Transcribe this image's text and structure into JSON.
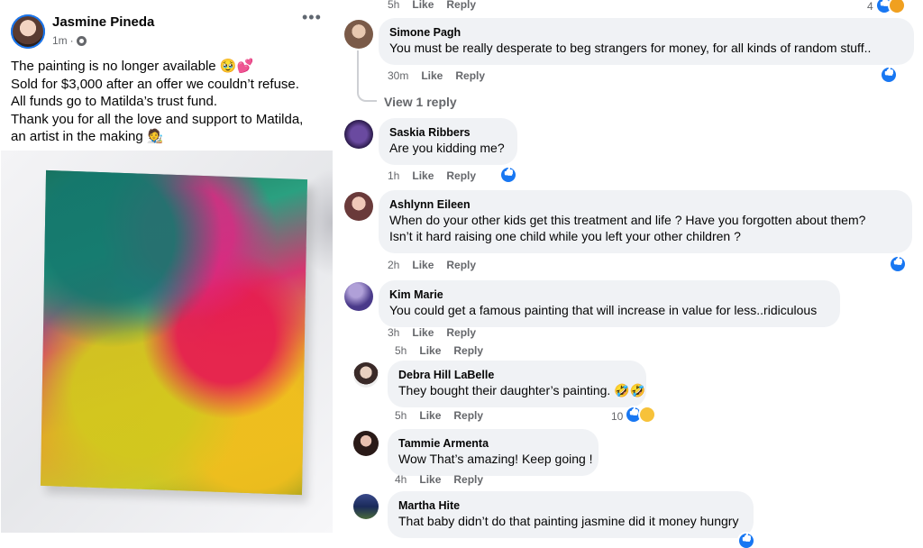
{
  "post": {
    "author": "Jasmine Pineda",
    "time": "1m",
    "privacy_icon": "globe-icon",
    "more_label": "•••",
    "lines": [
      "The painting is no longer available 🥹💕",
      "Sold for $3,000 after an offer we couldn’t refuse.",
      "All funds go to Matilda’s trust fund.",
      "Thank you for all the love and support to Matilda,",
      "an artist in the making 🧑‍🎨"
    ]
  },
  "top_partial": {
    "time": "5h",
    "like": "Like",
    "reply": "Reply",
    "reaction_count": "4"
  },
  "comments": [
    {
      "name": "Simone Pagh",
      "text": "You must be really desperate to beg strangers for money, for all kinds of random stuff..",
      "time": "30m",
      "like": "Like",
      "reply": "Reply"
    },
    {
      "name": "Saskia Ribbers",
      "text": "Are you kidding me?",
      "time": "1h",
      "like": "Like",
      "reply": "Reply"
    },
    {
      "name": "Ashlynn Eileen",
      "text": "When do your other kids get this treatment and life ? Have you forgotten about them? Isn’t it hard raising one child while you left your other children ?",
      "text_line1": "When do your other kids get this treatment and life ? Have you forgotten about them?",
      "text_line2": "Isn’t it hard raising one child while you left your other children ?",
      "time": "2h",
      "like": "Like",
      "reply": "Reply"
    },
    {
      "name": "Kim Marie",
      "text": "You could get a famous painting that will increase in value for less..ridiculous",
      "time": "3h",
      "like": "Like",
      "reply": "Reply"
    }
  ],
  "view_reply": "View 1 reply",
  "kim_extra_actions": {
    "time": "5h",
    "like": "Like",
    "reply": "Reply"
  },
  "replies": [
    {
      "name": "Debra Hill LaBelle",
      "text": "They bought their daughter’s painting. 🤣🤣",
      "time": "5h",
      "like": "Like",
      "reply": "Reply",
      "reaction_count": "10"
    },
    {
      "name": "Tammie Armenta",
      "text": "Wow That’s amazing! Keep going !",
      "time": "4h",
      "like": "Like",
      "reply": "Reply"
    },
    {
      "name": "Martha Hite",
      "text": "That baby didn’t do that painting jasmine did it money hungry"
    }
  ],
  "colors": {
    "accent": "#1877f2",
    "bubble": "#f0f2f5",
    "muted": "#65676b"
  }
}
